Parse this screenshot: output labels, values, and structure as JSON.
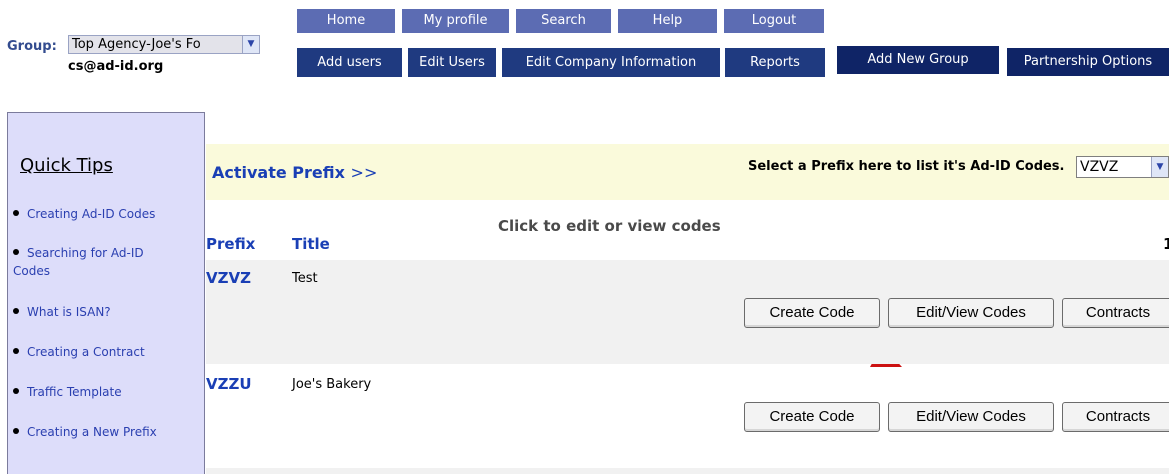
{
  "header": {
    "group_label": "Group:",
    "group_value": "Top Agency-Joe's Fo",
    "user_email": "cs@ad-id.org"
  },
  "nav": {
    "top": [
      "Home",
      "My profile",
      "Search",
      "Help",
      "Logout"
    ],
    "bottom": [
      "Add users",
      "Edit Users",
      "Edit Company Information",
      "Reports"
    ],
    "add_group": "Add New Group",
    "partnership": "Partnership Options"
  },
  "sidebar": {
    "title": "Quick Tips",
    "tips": [
      "Creating Ad-ID Codes",
      "Searching for Ad-ID Codes",
      "What is ISAN?",
      "Creating a Contract",
      "Traffic Template",
      "Creating a New Prefix"
    ]
  },
  "main": {
    "activate_label": "Activate Prefix",
    "activate_arrow": ">>",
    "select_label": "Select a Prefix here to list it's Ad-ID Codes.",
    "selected_prefix": "VZVZ",
    "annotation": "Click to edit or view codes",
    "col_prefix": "Prefix",
    "col_title": "Title",
    "page_count": "1",
    "rows": [
      {
        "prefix": "VZVZ",
        "title": "Test"
      },
      {
        "prefix": "VZZU",
        "title": "Joe's Bakery"
      }
    ],
    "buttons": {
      "create": "Create Code",
      "edit": "Edit/View Codes",
      "contracts": "Contracts"
    }
  },
  "colors": {
    "nav_top": "#5c6cb3",
    "nav_bottom": "#1f3a80",
    "sidebar_bg": "#ddddfa",
    "activate_bg": "#fafadb",
    "link": "#1a3fb5",
    "arrow": "#cc1111"
  }
}
